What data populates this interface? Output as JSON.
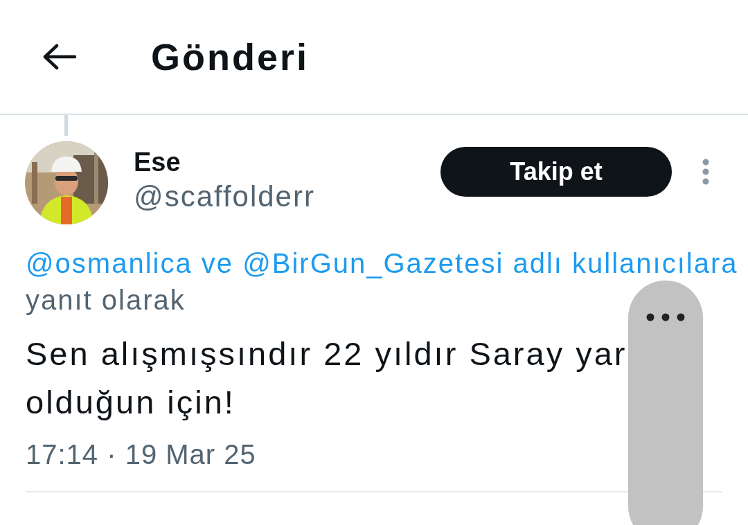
{
  "header": {
    "title": "Gönderi"
  },
  "author": {
    "name": "Ese",
    "handle": "@scaffolderr"
  },
  "follow_button": {
    "label": "Takip et"
  },
  "reply_context": {
    "mentions": "@osmanlica ve @BirGun_Gazetesi adlı kullanıcılara",
    "suffix": "yanıt olarak"
  },
  "tweet": {
    "lines": [
      "Sen alışmışsındır 22 yıldır Saray yar",
      "olduğun için!"
    ]
  },
  "timestamp": "17:14 · 19 Mar 25"
}
